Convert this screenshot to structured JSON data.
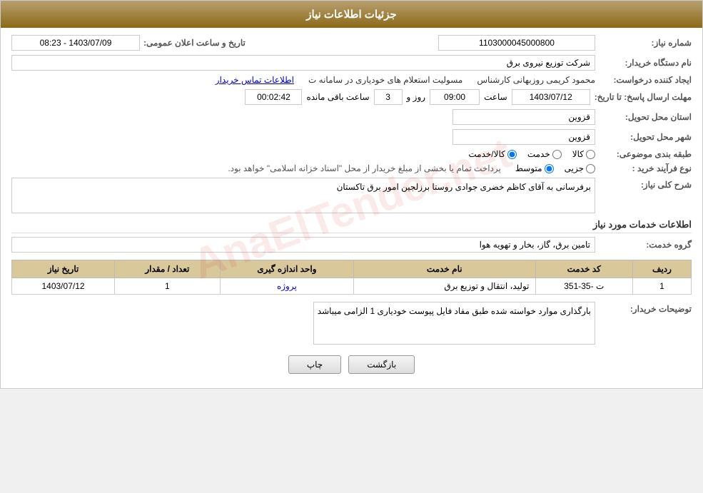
{
  "header": {
    "title": "جزئیات اطلاعات نیاز"
  },
  "fields": {
    "request_number_label": "شماره نیاز:",
    "request_number_value": "1103000045000800",
    "requester_org_label": "نام دستگاه خریدار:",
    "requester_org_value": "شرکت توزیع نیروی برق",
    "creator_label": "ایجاد کننده درخواست:",
    "creator_name": "محمود کریمی روزبهانی کارشناس",
    "creator_role": "مسولیت استعلام های خودیاری در سامانه ت",
    "creator_contact": "اطلاعات تماس خریدار",
    "deadline_label": "مهلت ارسال پاسخ: تا تاریخ:",
    "deadline_date": "1403/07/12",
    "deadline_time_label": "ساعت",
    "deadline_time": "09:00",
    "deadline_days_label": "روز و",
    "deadline_days": "3",
    "deadline_remaining_label": "ساعت باقی مانده",
    "deadline_remaining": "00:02:42",
    "province_label": "استان محل تحویل:",
    "province_value": "قزوین",
    "city_label": "شهر محل تحویل:",
    "city_value": "قزوین",
    "category_label": "طبقه بندی موضوعی:",
    "category_kala": "کالا",
    "category_khedmat": "خدمت",
    "category_kala_khedmat": "کالا/خدمت",
    "purchase_type_label": "نوع فرآیند خرید :",
    "purchase_jozei": "جزیی",
    "purchase_motavasset": "متوسط",
    "purchase_text": "پرداخت تمام یا بخشی از مبلغ خریدار از محل \"اسناد خزانه اسلامی\" خواهد بود.",
    "description_label": "شرح کلی نیاز:",
    "description_value": "برفرسانی به آقای کاظم خضری جوادی روستا برزلجین امور برق تاکستان",
    "services_label": "اطلاعات خدمات مورد نیاز",
    "service_group_label": "گروه خدمت:",
    "service_group_value": "تامین برق، گاز، بخار و تهویه هوا",
    "table": {
      "headers": [
        "ردیف",
        "کد خدمت",
        "نام خدمت",
        "واحد اندازه گیری",
        "تعداد / مقدار",
        "تاریخ نیاز"
      ],
      "rows": [
        {
          "row": "1",
          "code": "ت -35-351",
          "name": "تولید، انتقال و توزیع برق",
          "unit": "پروژه",
          "quantity": "1",
          "date": "1403/07/12"
        }
      ]
    },
    "buyer_desc_label": "توضیحات خریدار:",
    "buyer_desc_value": "بارگذاری موارد خواسته شده طبق مفاد فایل پیوست خودیاری 1 الزامی میباشد",
    "announcement_date_label": "تاریخ و ساعت اعلان عمومی:",
    "announcement_date_value": "1403/07/09 - 08:23"
  },
  "buttons": {
    "print": "چاپ",
    "back": "بازگشت"
  },
  "watermark": "AnaElTender.net"
}
